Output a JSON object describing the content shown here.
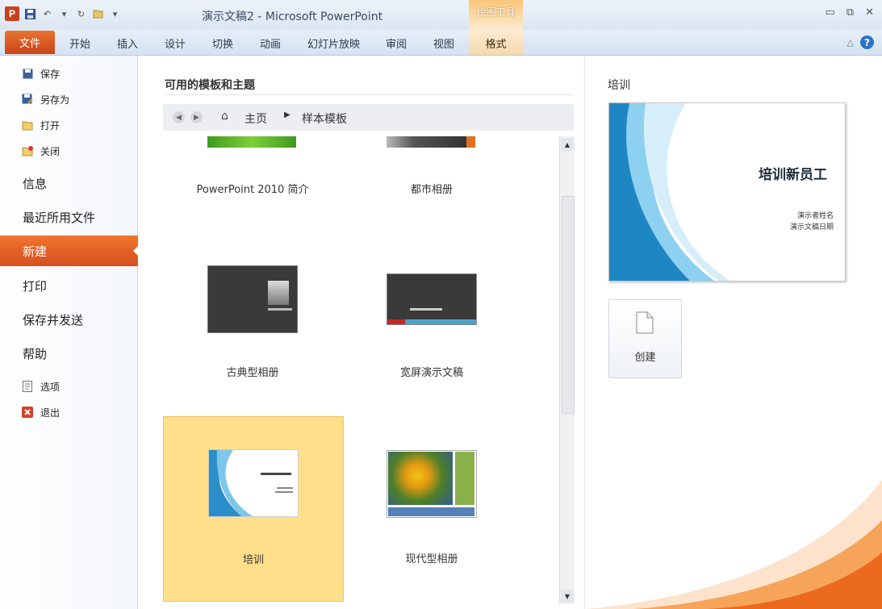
{
  "window": {
    "title": "演示文稿2 - Microsoft PowerPoint",
    "app_icon": "P",
    "context_header": "绘图工具",
    "controls": [
      "minimize-icon",
      "restore-icon",
      "close-icon"
    ]
  },
  "ribbon": {
    "file_tab": "文件",
    "tabs": [
      "开始",
      "插入",
      "设计",
      "切换",
      "动画",
      "幻灯片放映",
      "审阅",
      "视图"
    ],
    "context_tab": "格式"
  },
  "backstage": {
    "small_items": [
      {
        "icon": "save-icon",
        "label": "保存"
      },
      {
        "icon": "save-as-icon",
        "label": "另存为"
      },
      {
        "icon": "open-folder-icon",
        "label": "打开"
      },
      {
        "icon": "close-folder-icon",
        "label": "关闭"
      }
    ],
    "big_items": [
      "信息",
      "最近所用文件",
      "新建",
      "打印",
      "保存并发送",
      "帮助"
    ],
    "active_item": "新建",
    "bottom_items": [
      {
        "icon": "options-icon",
        "label": "选项"
      },
      {
        "icon": "exit-icon",
        "label": "退出"
      }
    ]
  },
  "center": {
    "heading": "可用的模板和主题",
    "breadcrumb": {
      "home": "主页",
      "current": "样本模板"
    },
    "templates": [
      {
        "caption": "PowerPoint 2010 简介"
      },
      {
        "caption": "都市相册"
      },
      {
        "caption": "古典型相册"
      },
      {
        "caption": "宽屏演示文稿"
      },
      {
        "caption": "培训",
        "selected": true
      },
      {
        "caption": "现代型相册"
      }
    ]
  },
  "right": {
    "title": "培训",
    "preview": {
      "title": "培训新员工",
      "line1": "演示者姓名",
      "line2": "演示文稿日期"
    },
    "create_label": "创建"
  },
  "colors": {
    "file_tab": "#d6501f",
    "selected_template": "#ffe08a",
    "accent_blue": "#2b73c9"
  }
}
